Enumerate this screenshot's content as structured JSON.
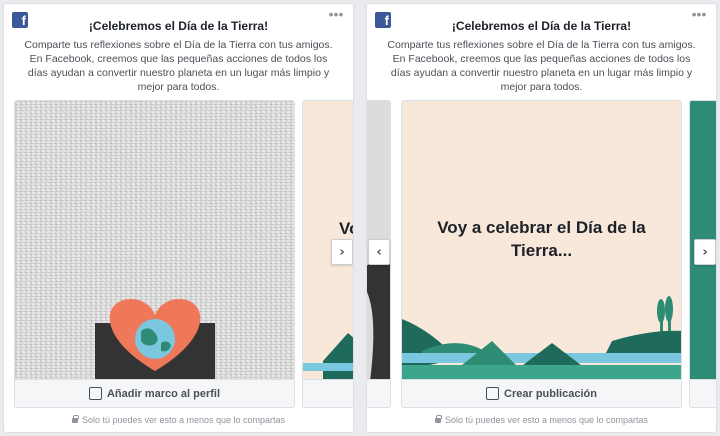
{
  "brand_logo": "f",
  "more_icon": "•••",
  "cards": [
    {
      "title": "¡Celebremos el Día de la Tierra!",
      "description": "Comparte tus reflexiones sobre el Día de la Tierra con tus amigos. En Facebook, creemos que las pequeñas acciones de todos los días ayudan a convertir nuestro planeta en un lugar más limpio y mejor para todos.",
      "action_label": "Añadir marco al perfil",
      "peek_text": "Vo",
      "privacy": "Solo tú puedes ver esto a menos que lo compartas"
    },
    {
      "title": "¡Celebremos el Día de la Tierra!",
      "description": "Comparte tus reflexiones sobre el Día de la Tierra con tus amigos. En Facebook, creemos que las pequeñas acciones de todos los días ayudan a convertir nuestro planeta en un lugar más limpio y mejor para todos.",
      "action_label": "Crear publicación",
      "slide_text": "Voy a celebrar el Día de la Tierra...",
      "privacy": "Solo tú puedes ver esto a menos que lo compartas"
    }
  ],
  "arrows": {
    "next": "›",
    "prev": "‹"
  },
  "colors": {
    "facebook_blue": "#3b5998",
    "slide_bg": "#f8e8d9",
    "heart": "#f0785a",
    "teal_dark": "#1e6b5c",
    "teal": "#2e8b74",
    "water": "#7ac7e0"
  }
}
